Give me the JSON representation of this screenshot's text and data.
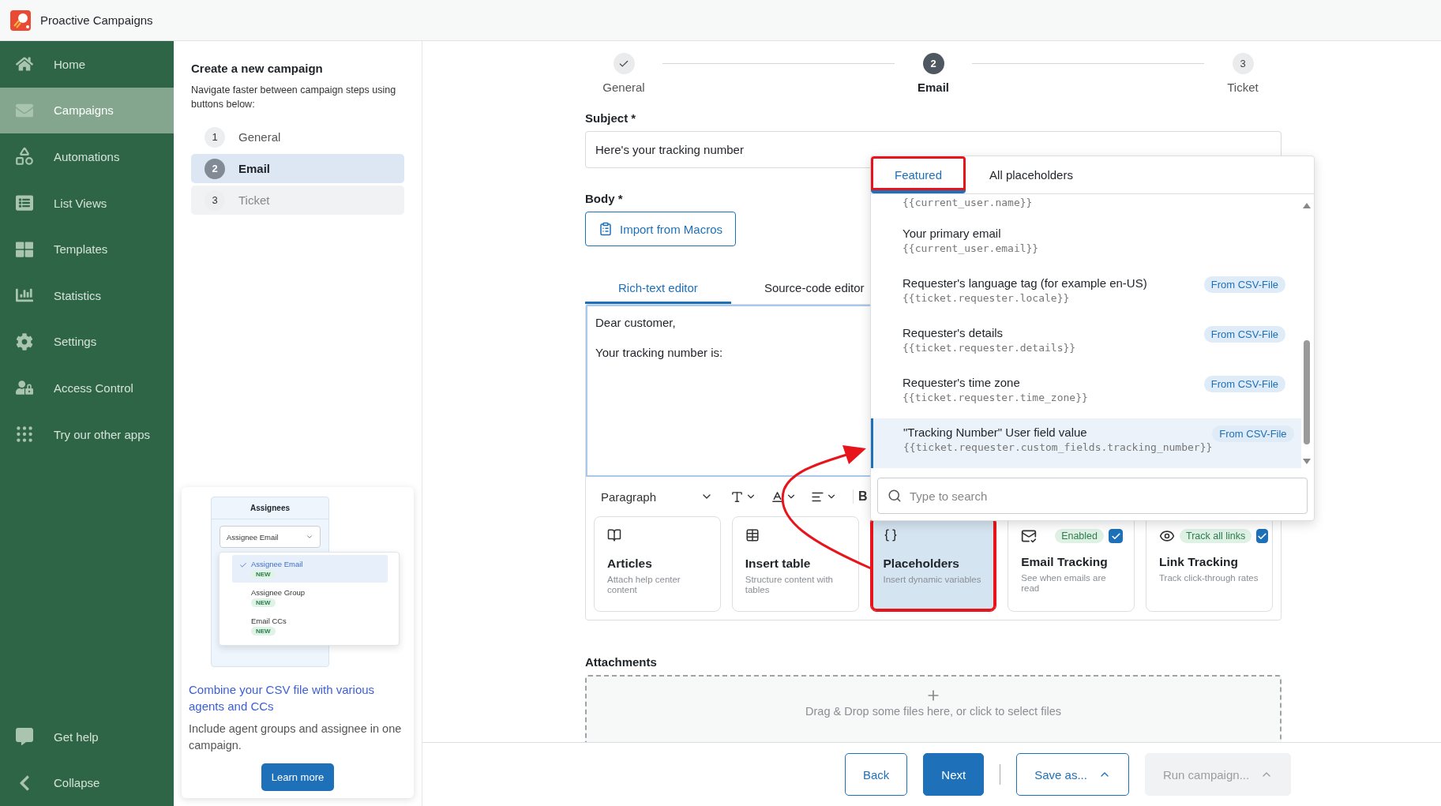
{
  "app": {
    "title": "Proactive Campaigns"
  },
  "sidebar": {
    "items": [
      {
        "label": "Home",
        "selected": false
      },
      {
        "label": "Campaigns",
        "selected": true
      },
      {
        "label": "Automations",
        "selected": false
      },
      {
        "label": "List Views",
        "selected": false
      },
      {
        "label": "Templates",
        "selected": false
      },
      {
        "label": "Statistics",
        "selected": false
      },
      {
        "label": "Settings",
        "selected": false
      },
      {
        "label": "Access Control",
        "selected": false
      },
      {
        "label": "Try our other apps",
        "selected": false
      }
    ],
    "footer_items": [
      {
        "label": "Get help"
      },
      {
        "label": "Collapse"
      }
    ]
  },
  "steps_panel": {
    "title": "Create a new campaign",
    "subtitle": "Navigate faster between campaign steps using buttons below:",
    "steps": [
      {
        "number": "1",
        "label": "General",
        "selected": false,
        "disabled": false
      },
      {
        "number": "2",
        "label": "Email",
        "selected": true,
        "disabled": false
      },
      {
        "number": "3",
        "label": "Ticket",
        "selected": false,
        "disabled": true
      }
    ]
  },
  "promo": {
    "mock": {
      "header": "Assignees",
      "select_value": "Assignee Email",
      "options": [
        {
          "label": "Assignee Email",
          "checked": true,
          "badge": "NEW"
        },
        {
          "label": "Assignee Group",
          "checked": false,
          "badge": "NEW"
        },
        {
          "label": "Email CCs",
          "checked": false,
          "badge": "NEW"
        }
      ]
    },
    "title": "Combine your CSV file with various agents and CCs",
    "text": "Include agent groups and assignee in one campaign.",
    "button": "Learn more"
  },
  "stepper": [
    {
      "label": "General",
      "done": true,
      "selected": false
    },
    {
      "number": "2",
      "label": "Email",
      "done": false,
      "selected": true
    },
    {
      "number": "3",
      "label": "Ticket",
      "done": false,
      "selected": false
    }
  ],
  "form": {
    "subject": {
      "label": "Subject *",
      "value": "Here's your tracking number"
    },
    "body": {
      "label": "Body *",
      "import_button": "Import from Macros",
      "editor_tabs": [
        {
          "label": "Rich-text editor",
          "selected": true
        },
        {
          "label": "Source-code editor",
          "selected": false
        }
      ],
      "content": [
        "Dear customer,",
        "Your tracking number is:"
      ]
    },
    "toolbar": {
      "block_format": "Paragraph",
      "bold": "B"
    },
    "features": [
      {
        "title": "Articles",
        "description": "Attach help center content",
        "selected": false,
        "highlighted": false
      },
      {
        "title": "Insert table",
        "description": "Structure content with tables",
        "selected": false,
        "highlighted": false
      },
      {
        "title": "Placeholders",
        "description": "Insert dynamic variables",
        "selected": true,
        "highlighted": true
      },
      {
        "title": "Email Tracking",
        "description": "See when emails are read",
        "selected": false,
        "highlighted": false,
        "badge": "Enabled",
        "checked": true
      },
      {
        "title": "Link Tracking",
        "description": "Track click-through rates",
        "selected": false,
        "highlighted": false,
        "badge": "Track all links",
        "checked": true
      }
    ],
    "attachments": {
      "label": "Attachments",
      "dropzone": "Drag & Drop some files here, or click to select files"
    }
  },
  "footer": {
    "buttons": [
      {
        "label": "Back",
        "kind": "secondary",
        "disabled": false
      },
      {
        "label": "Next",
        "kind": "primary",
        "disabled": false
      },
      {
        "label": "Save as...",
        "kind": "menu",
        "disabled": false
      },
      {
        "label": "Run campaign...",
        "kind": "menu",
        "disabled": true
      }
    ]
  },
  "placeholder_menu": {
    "tabs": [
      {
        "label": "Featured",
        "selected": true,
        "highlighted": true
      },
      {
        "label": "All placeholders",
        "selected": false,
        "highlighted": false
      }
    ],
    "items": [
      {
        "code": "{{current_user.name}}",
        "selected": false
      },
      {
        "label": "Your primary email",
        "code": "{{current_user.email}}",
        "selected": false
      },
      {
        "label": "Requester's language tag (for example en-US)",
        "code": "{{ticket.requester.locale}}",
        "badge": "From CSV-File",
        "selected": false
      },
      {
        "label": "Requester's details",
        "code": "{{ticket.requester.details}}",
        "badge": "From CSV-File",
        "selected": false
      },
      {
        "label": "Requester's time zone",
        "code": "{{ticket.requester.time_zone}}",
        "badge": "From CSV-File",
        "selected": false
      },
      {
        "label": "\"Tracking Number\" User field value",
        "code": "{{ticket.requester.custom_fields.tracking_number}}",
        "badge": "From CSV-File",
        "selected": true
      }
    ],
    "search": {
      "placeholder": "Type to search"
    }
  },
  "annotation": {
    "arrow": true
  }
}
